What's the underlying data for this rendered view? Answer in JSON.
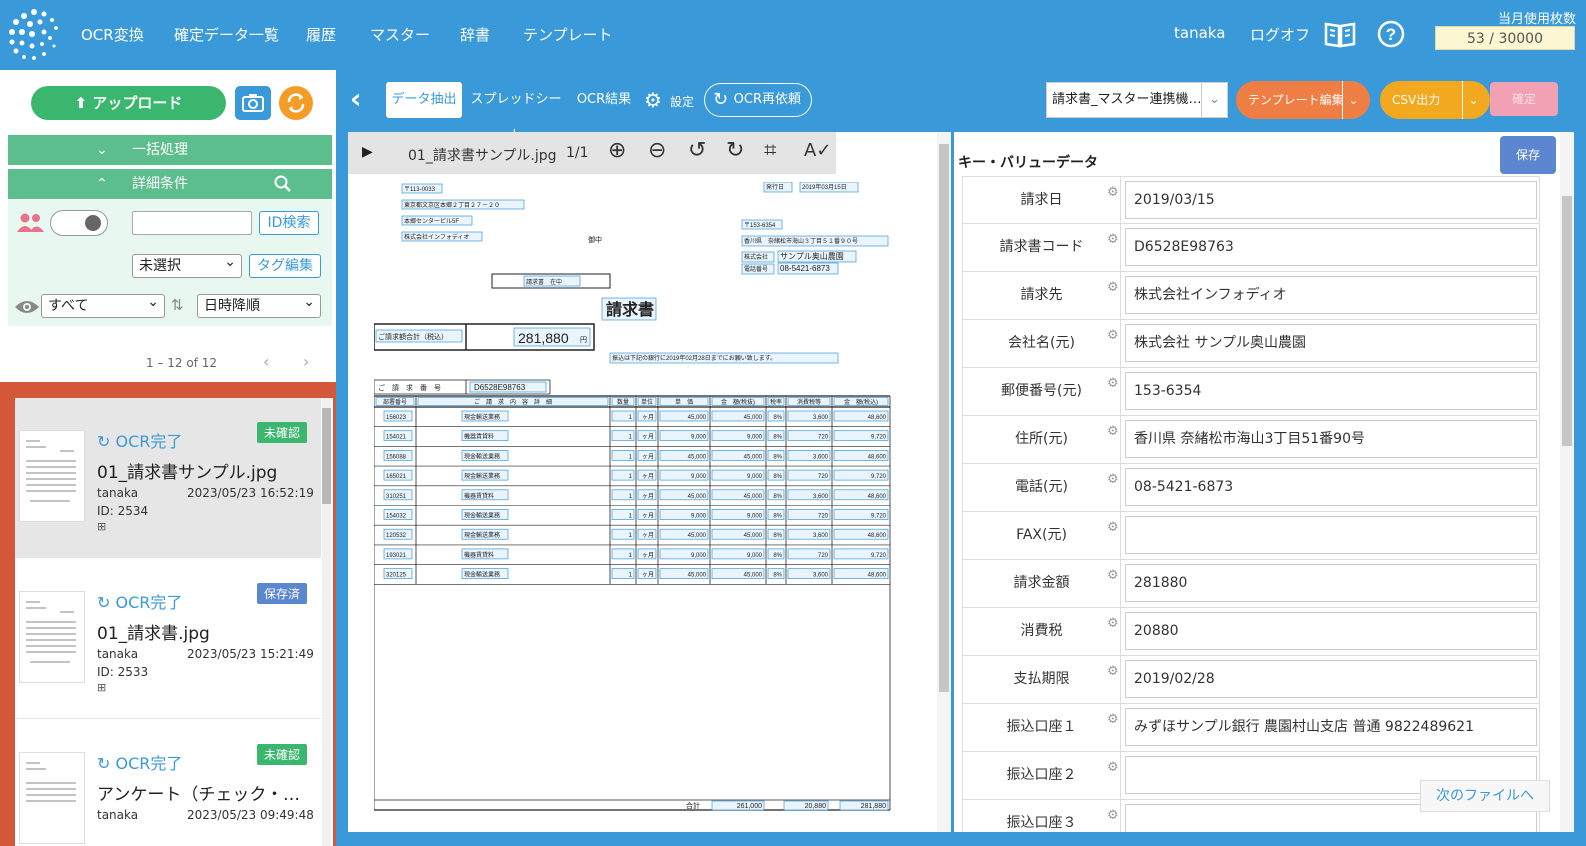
{
  "topbar": {
    "nav": [
      "OCR変換",
      "確定データ一覧",
      "履歴",
      "マスター",
      "辞書",
      "テンプレート"
    ],
    "user": "tanaka",
    "logoff": "ログオフ",
    "usage_label": "当月使用枚数",
    "usage_value": "53 / 30000"
  },
  "left": {
    "upload": "アップロード",
    "bulk": "一括処理",
    "detail": "詳細条件",
    "id_search": "ID検索",
    "tag_select": "未選択",
    "tag_edit": "タグ編集",
    "view_select": "すべて",
    "sort_select": "日時降順",
    "pager": "1 – 12 of 12"
  },
  "files": [
    {
      "status": "OCR完了",
      "badge": "未確認",
      "badge_color": "#3bb66e",
      "name": "01_請求書サンプル.jpg",
      "user": "tanaka",
      "date": "2023/05/23 16:52:19",
      "id": "ID: 2534",
      "selected": true
    },
    {
      "status": "OCR完了",
      "badge": "保存済",
      "badge_color": "#5d86d1",
      "name": "01_請求書.jpg",
      "user": "tanaka",
      "date": "2023/05/23 15:21:49",
      "id": "ID: 2533",
      "selected": false
    },
    {
      "status": "OCR完了",
      "badge": "未確認",
      "badge_color": "#3bb66e",
      "name": "アンケート（チェック・…",
      "user": "tanaka",
      "date": "2023/05/23 09:49:48",
      "id": "",
      "selected": false
    }
  ],
  "toolbar": {
    "tabs": [
      "データ抽出",
      "スプレッドシート",
      "OCR結果"
    ],
    "settings": "設定",
    "reocr": "OCR再依頼",
    "template": "請求書_マスター連携機…",
    "template_edit": "テンプレート編集",
    "csv": "CSV出力",
    "confirm": "確定"
  },
  "viewer": {
    "filename": "01_請求書サンプル.jpg",
    "page": "1/1",
    "doc": {
      "postal": "〒113-0033",
      "addr": "東京都文京区本郷２丁目２７－２０",
      "bldg": "本郷センタービル5F",
      "company": "株式会社インフォディオ",
      "onchu": "御中",
      "issued_label": "発行日",
      "issued": "2019年03月15日",
      "to_postal": "〒153-6354",
      "to_addr": "香川県　奈緒松市海山３丁目５１番９０号",
      "to_company_label": "株式会社",
      "to_company": "サンプル奥山農園",
      "tel_label": "電話番号",
      "tel": "08-5421-6873",
      "title_small": "請求書　在中",
      "title": "請求書",
      "total_label": "ご請求額合計（税込）",
      "total": "281,880",
      "yen": "円",
      "note": "振込は下記の銀行に2019年02月28日までにお願い致します。",
      "code_label": "ご　請　求　番　号",
      "code": "D6528E98763",
      "headers": [
        "部署番号",
        "ご　請　求　内　容　詳　細",
        "数量",
        "単位",
        "単　価",
        "金　額(税抜)",
        "税率",
        "消費税等",
        "金　額(税込)"
      ],
      "rows": [
        [
          "156023",
          "現金輸送業務",
          "1",
          "ヶ月",
          "45,000",
          "45,000",
          "8%",
          "3,600",
          "48,600"
        ],
        [
          "154021",
          "機器賃貸料",
          "1",
          "ヶ月",
          "9,000",
          "9,000",
          "8%",
          "720",
          "9,720"
        ],
        [
          "156088",
          "現金輸送業務",
          "1",
          "ヶ月",
          "45,000",
          "45,000",
          "8%",
          "3,600",
          "48,600"
        ],
        [
          "165021",
          "現金輸送業務",
          "1",
          "ヶ月",
          "9,000",
          "9,000",
          "8%",
          "720",
          "9,720"
        ],
        [
          "310251",
          "機器賃貸料",
          "1",
          "ヶ月",
          "45,000",
          "45,000",
          "8%",
          "3,600",
          "48,600"
        ],
        [
          "154032",
          "現金輸送業務",
          "1",
          "ヶ月",
          "9,000",
          "9,000",
          "8%",
          "720",
          "9,720"
        ],
        [
          "120532",
          "現金輸送業務",
          "1",
          "ヶ月",
          "45,000",
          "45,000",
          "8%",
          "3,600",
          "48,600"
        ],
        [
          "193021",
          "機器賃貸料",
          "1",
          "ヶ月",
          "9,000",
          "9,000",
          "8%",
          "720",
          "9,720"
        ],
        [
          "320125",
          "現金輸送業務",
          "1",
          "ヶ月",
          "45,000",
          "45,000",
          "8%",
          "3,600",
          "48,600"
        ]
      ],
      "sum_label": "合計",
      "sum_ex": "261,000",
      "sum_tax": "20,880",
      "sum_in": "281,880"
    }
  },
  "kv": {
    "title": "キー・バリューデータ",
    "save": "保存",
    "next": "次のファイルへ",
    "rows": [
      {
        "label": "請求日",
        "value": "2019/03/15"
      },
      {
        "label": "請求書コード",
        "value": "D6528E98763"
      },
      {
        "label": "請求先",
        "value": "株式会社インフォディオ"
      },
      {
        "label": "会社名(元)",
        "value": "株式会社 サンプル奥山農園"
      },
      {
        "label": "郵便番号(元)",
        "value": "153-6354"
      },
      {
        "label": "住所(元)",
        "value": "香川県 奈緒松市海山3丁目51番90号"
      },
      {
        "label": "電話(元)",
        "value": "08-5421-6873"
      },
      {
        "label": "FAX(元)",
        "value": ""
      },
      {
        "label": "請求金額",
        "value": "281880"
      },
      {
        "label": "消費税",
        "value": "20880"
      },
      {
        "label": "支払期限",
        "value": "2019/02/28"
      },
      {
        "label": "振込口座１",
        "value": "みずほサンプル銀行 農園村山支店 普通 9822489621"
      },
      {
        "label": "振込口座２",
        "value": ""
      },
      {
        "label": "振込口座３",
        "value": ""
      }
    ]
  }
}
